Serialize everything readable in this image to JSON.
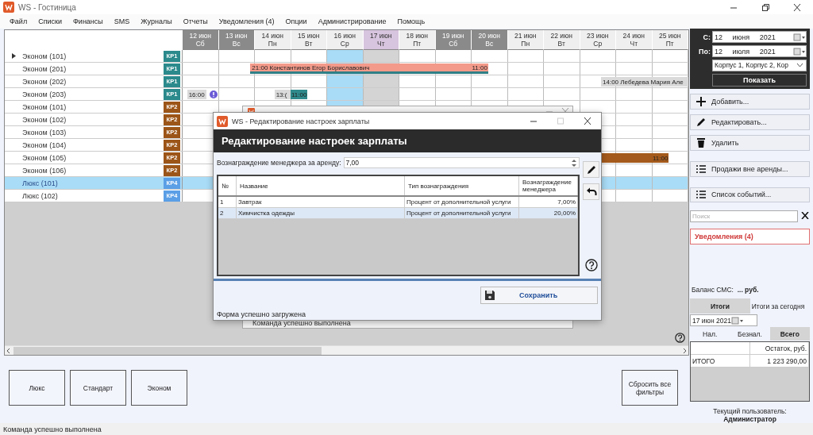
{
  "window": {
    "title": "WS - Гостиница"
  },
  "menu": [
    "Файл",
    "Списки",
    "Финансы",
    "SMS",
    "Журналы",
    "Отчеты",
    "Уведомления (4)",
    "Опции",
    "Администрирование",
    "Помощь"
  ],
  "schedule": {
    "days": [
      {
        "date": "12 июн",
        "weekday": "Сб",
        "kind": "weekend"
      },
      {
        "date": "13 июн",
        "weekday": "Вс",
        "kind": "weekend"
      },
      {
        "date": "14 июн",
        "weekday": "Пн",
        "kind": "weekday"
      },
      {
        "date": "15 июн",
        "weekday": "Вт",
        "kind": "weekday"
      },
      {
        "date": "16 июн",
        "weekday": "Ср",
        "kind": "today"
      },
      {
        "date": "17 июн",
        "weekday": "Чт",
        "kind": "selected"
      },
      {
        "date": "18 июн",
        "weekday": "Пт",
        "kind": "weekday"
      },
      {
        "date": "19 июн",
        "weekday": "Сб",
        "kind": "weekend"
      },
      {
        "date": "20 июн",
        "weekday": "Вс",
        "kind": "weekend"
      },
      {
        "date": "21 июн",
        "weekday": "Пн",
        "kind": "weekday"
      },
      {
        "date": "22 июн",
        "weekday": "Вт",
        "kind": "weekday"
      },
      {
        "date": "23 июн",
        "weekday": "Ср",
        "kind": "weekday"
      },
      {
        "date": "24 июн",
        "weekday": "Чт",
        "kind": "weekday"
      },
      {
        "date": "25 июн",
        "weekday": "Пт",
        "kind": "weekday"
      }
    ],
    "rooms": [
      {
        "name": "Эконом (101)",
        "building": "КР1",
        "color": "#2b8a8c",
        "selected": false,
        "current": true
      },
      {
        "name": "Эконом (201)",
        "building": "КР1",
        "color": "#2b8a8c",
        "selected": false,
        "current": false,
        "bookings": [
          {
            "kind": "stay",
            "label": "21:00 Константинов Егор Бориславович",
            "end_label": "11:00"
          }
        ]
      },
      {
        "name": "Эконом (202)",
        "building": "КР1",
        "color": "#2b8a8c",
        "selected": false,
        "current": false,
        "bookings": [
          {
            "kind": "pending",
            "label": "14:00 Лебедева Мария Але"
          }
        ]
      },
      {
        "name": "Эконом (203)",
        "building": "КР1",
        "color": "#2b8a8c",
        "selected": false,
        "current": false,
        "bookings": [
          {
            "kind": "pending",
            "label": "16:00",
            "warning": true
          },
          {
            "kind": "pending",
            "label": "13:(",
            "end_label": "11:00"
          }
        ]
      },
      {
        "name": "Эконом (101)",
        "building": "КР2",
        "color": "#9c5518",
        "selected": false,
        "current": false
      },
      {
        "name": "Эконом (102)",
        "building": "КР2",
        "color": "#9c5518",
        "selected": false,
        "current": false
      },
      {
        "name": "Эконом (103)",
        "building": "КР2",
        "color": "#9c5518",
        "selected": false,
        "current": false
      },
      {
        "name": "Эконом (104)",
        "building": "КР2",
        "color": "#9c5518",
        "selected": false,
        "current": false
      },
      {
        "name": "Эконом (105)",
        "building": "КР2",
        "color": "#9c5518",
        "selected": false,
        "current": false,
        "bookings": [
          {
            "kind": "occupied",
            "end_label": "11:00"
          }
        ]
      },
      {
        "name": "Эконом (106)",
        "building": "КР2",
        "color": "#9c5518",
        "selected": false,
        "current": false
      },
      {
        "name": "Люкс (101)",
        "building": "КР4",
        "color": "#5b9fe6",
        "selected": true,
        "current": false
      },
      {
        "name": "Люкс (102)",
        "building": "КР4",
        "color": "#5b9fe6",
        "selected": false,
        "current": false
      }
    ]
  },
  "back_window": {
    "status": "Команда успешно выполнена"
  },
  "dialog": {
    "title": "WS - Редактирование настроек зарплаты",
    "heading": "Редактирование настроек зарплаты",
    "field": {
      "label": "Вознаграждение менеджера за аренду:",
      "value": "7,00"
    },
    "table": {
      "columns": [
        "№",
        "Название",
        "Тип вознаграждения",
        "Вознаграждение менеджера"
      ],
      "rows": [
        {
          "cells": [
            "1",
            "Завтрак",
            "Процент от дополнительной услуги",
            "7,00%"
          ],
          "selected": false
        },
        {
          "cells": [
            "2",
            "Химчистка одежды",
            "Процент от дополнительной услуги",
            "20,00%"
          ],
          "selected": true
        }
      ]
    },
    "save_button": "Сохранить",
    "status": "Форма успешно загружена"
  },
  "room_filters": [
    "Люкс",
    "Стандарт",
    "Эконом"
  ],
  "reset_button": "Сбросить все фильтры",
  "filter": {
    "from": {
      "label": "С:",
      "value": "12 июня 2021"
    },
    "to": {
      "label": "По:",
      "value": "12 июля 2021"
    },
    "buildings": "Корпус 1, Корпус 2, Кор",
    "show_button": "Показать"
  },
  "action_groups": [
    [
      "Добавить...",
      "Редактировать...",
      "Удалить"
    ],
    [
      "Продажи вне аренды..."
    ],
    [
      "Список событий..."
    ]
  ],
  "search": {
    "placeholder": "Поиск"
  },
  "notifications": "Уведомления (4)",
  "sms_balance": "Баланс СМС:  **... руб.**",
  "totals": {
    "tabs": [
      {
        "label": "Итоги",
        "selected": true
      },
      {
        "label": "Итоги за сегодня",
        "selected": false
      }
    ],
    "date": "17 июн 2021",
    "payment_tabs": [
      {
        "label": "Нал.",
        "selected": false
      },
      {
        "label": "Безнал.",
        "selected": false
      },
      {
        "label": "Всего",
        "selected": true
      }
    ],
    "columns": [
      "",
      "Остаток, руб."
    ],
    "rows": [
      {
        "cells": [
          "ИТОГО",
          "1 223 290,00"
        ]
      }
    ]
  },
  "user": {
    "label": "Текущий пользователь:",
    "name": "Администратор"
  },
  "status_bar": "Команда успешно выполнена"
}
